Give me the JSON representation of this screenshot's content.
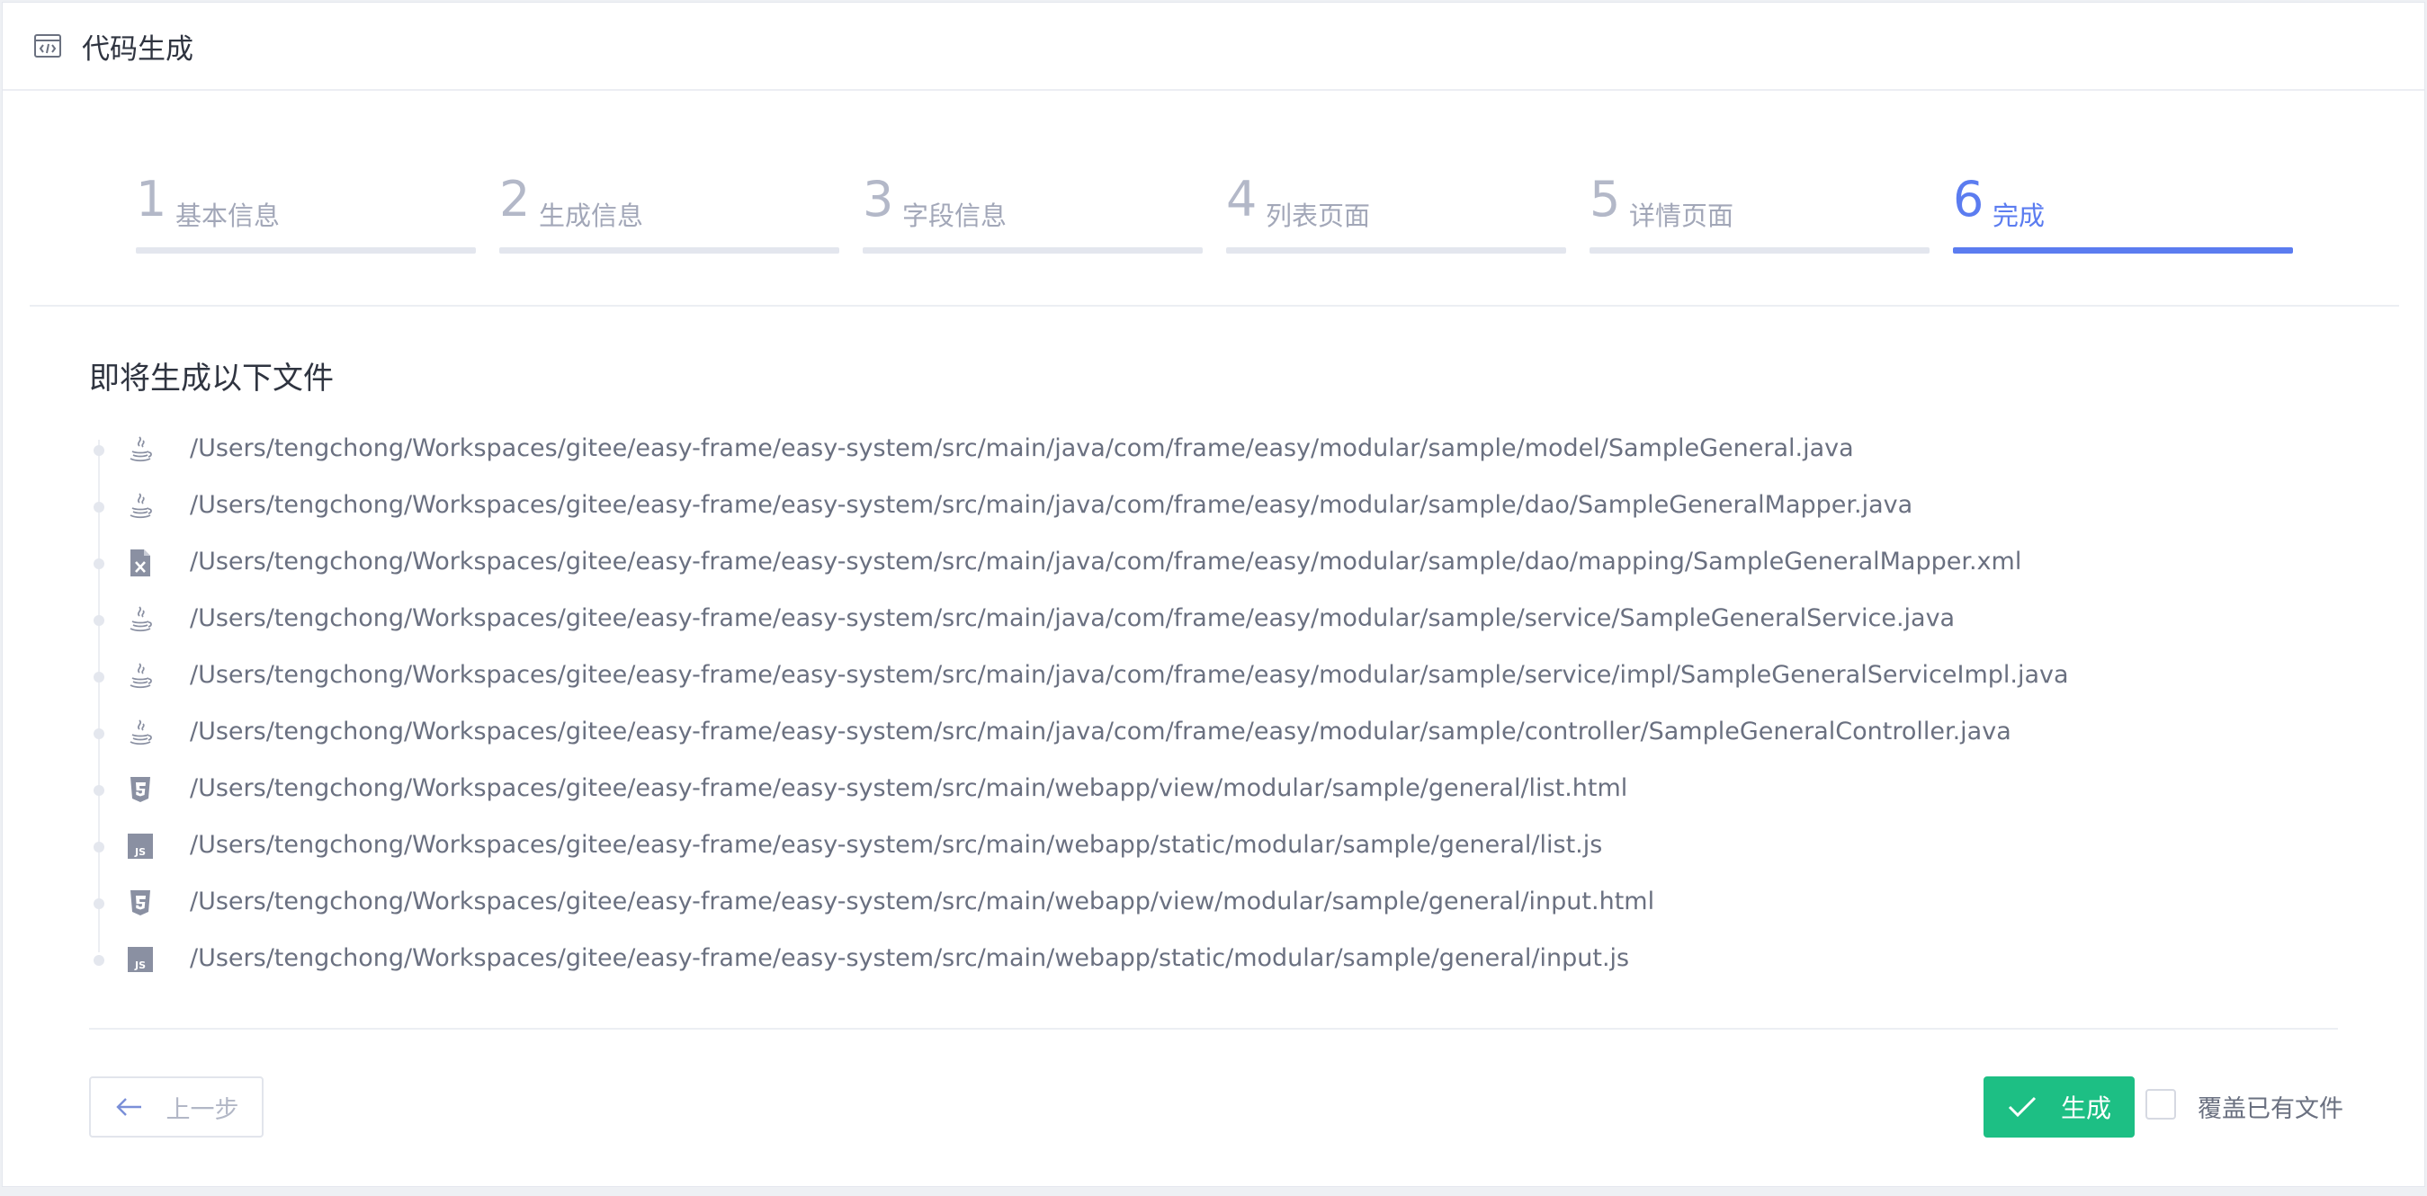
{
  "header": {
    "title": "代码生成",
    "icon": "code-window-icon"
  },
  "steps": [
    {
      "num": "1",
      "label": "基本信息",
      "active": false
    },
    {
      "num": "2",
      "label": "生成信息",
      "active": false
    },
    {
      "num": "3",
      "label": "字段信息",
      "active": false
    },
    {
      "num": "4",
      "label": "列表页面",
      "active": false
    },
    {
      "num": "5",
      "label": "详情页面",
      "active": false
    },
    {
      "num": "6",
      "label": "完成",
      "active": true
    }
  ],
  "section_title": "即将生成以下文件",
  "files": [
    {
      "icon": "java-icon",
      "path": "/Users/tengchong/Workspaces/gitee/easy-frame/easy-system/src/main/java/com/frame/easy/modular/sample/model/SampleGeneral.java"
    },
    {
      "icon": "java-icon",
      "path": "/Users/tengchong/Workspaces/gitee/easy-frame/easy-system/src/main/java/com/frame/easy/modular/sample/dao/SampleGeneralMapper.java"
    },
    {
      "icon": "xml-file-icon",
      "path": "/Users/tengchong/Workspaces/gitee/easy-frame/easy-system/src/main/java/com/frame/easy/modular/sample/dao/mapping/SampleGeneralMapper.xml"
    },
    {
      "icon": "java-icon",
      "path": "/Users/tengchong/Workspaces/gitee/easy-frame/easy-system/src/main/java/com/frame/easy/modular/sample/service/SampleGeneralService.java"
    },
    {
      "icon": "java-icon",
      "path": "/Users/tengchong/Workspaces/gitee/easy-frame/easy-system/src/main/java/com/frame/easy/modular/sample/service/impl/SampleGeneralServiceImpl.java"
    },
    {
      "icon": "java-icon",
      "path": "/Users/tengchong/Workspaces/gitee/easy-frame/easy-system/src/main/java/com/frame/easy/modular/sample/controller/SampleGeneralController.java"
    },
    {
      "icon": "html5-icon",
      "path": "/Users/tengchong/Workspaces/gitee/easy-frame/easy-system/src/main/webapp/view/modular/sample/general/list.html"
    },
    {
      "icon": "js-icon",
      "path": "/Users/tengchong/Workspaces/gitee/easy-frame/easy-system/src/main/webapp/static/modular/sample/general/list.js"
    },
    {
      "icon": "html5-icon",
      "path": "/Users/tengchong/Workspaces/gitee/easy-frame/easy-system/src/main/webapp/view/modular/sample/general/input.html"
    },
    {
      "icon": "js-icon",
      "path": "/Users/tengchong/Workspaces/gitee/easy-frame/easy-system/src/main/webapp/static/modular/sample/general/input.js"
    }
  ],
  "footer": {
    "prev_label": "上一步",
    "generate_label": "生成",
    "overwrite_label": "覆盖已有文件",
    "overwrite_checked": false
  },
  "colors": {
    "accent": "#5b7cf0",
    "success": "#1dbf84"
  }
}
